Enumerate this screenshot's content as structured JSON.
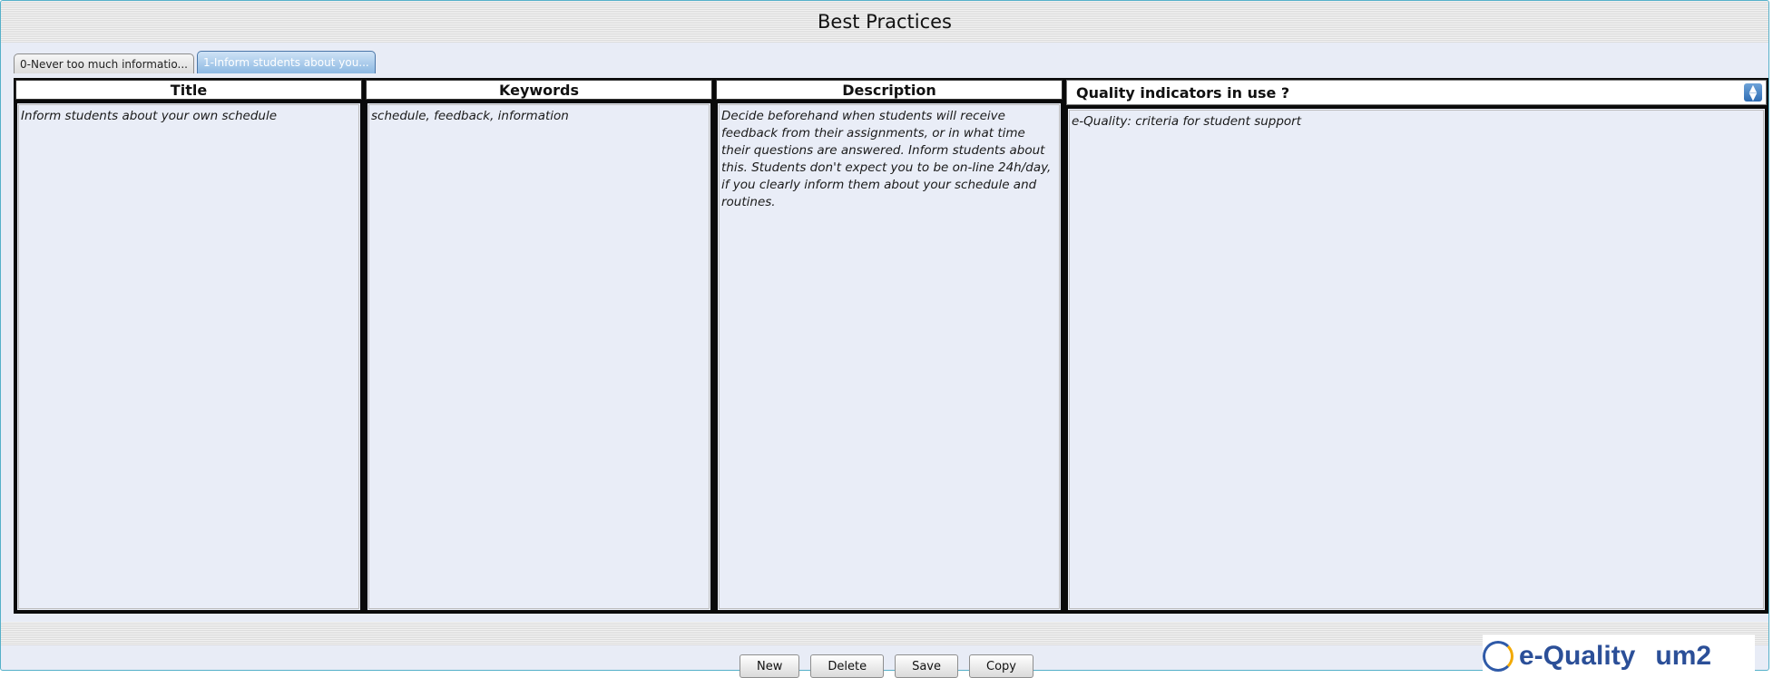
{
  "header": {
    "title": "Best Practices"
  },
  "tabs": [
    {
      "label": "0-Never too much informatio...",
      "active": false
    },
    {
      "label": "1-Inform students about you...",
      "active": true
    }
  ],
  "columns": {
    "title": {
      "header": "Title",
      "value": "Inform students about your own schedule"
    },
    "keywords": {
      "header": "Keywords",
      "value": "schedule, feedback, information"
    },
    "description": {
      "header": "Description",
      "value": "Decide beforehand when students will receive feedback from their assignments, or in what time their questions are answered. Inform students about this. Students don't expect you to be on-line 24h/day, if you clearly inform them about your schedule and routines."
    },
    "quality": {
      "selected": "Quality indicators in use ?",
      "value": "e-Quality: criteria for student support"
    }
  },
  "buttons": {
    "new": "New",
    "delete": "Delete",
    "save": "Save",
    "copy": "Copy"
  },
  "logo": {
    "name": "e-Quality",
    "partner": "um2"
  },
  "colors": {
    "frame_border": "#55b0c9",
    "panel_bg": "#e9edf7",
    "tab_active": "#8cb8e2",
    "logo_blue": "#2b4f98"
  },
  "icons": {
    "select": "updown-arrows-icon",
    "logo": "e-quality-logo-icon"
  }
}
